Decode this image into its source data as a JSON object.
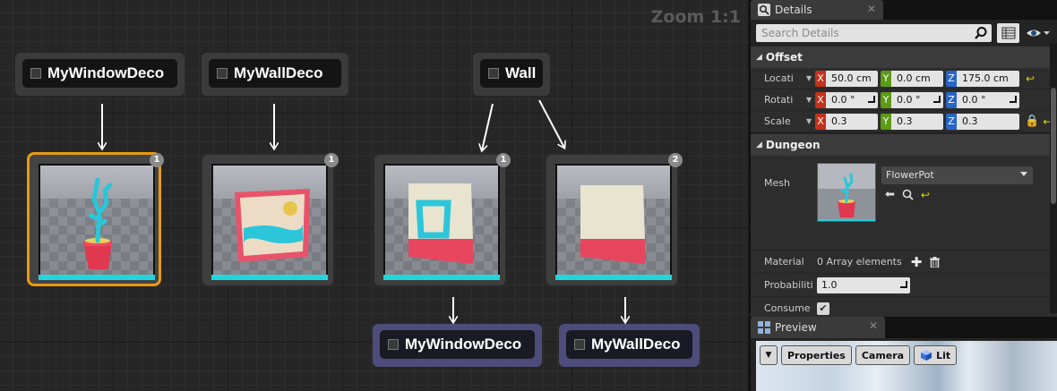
{
  "graph": {
    "zoom_label": "Zoom 1:1",
    "markers": {
      "top_left": "MyWindowDeco",
      "top_mid": "MyWallDeco",
      "top_right": "Wall",
      "bottom_left": "MyWindowDeco",
      "bottom_right": "MyWallDeco"
    },
    "visual_nodes": [
      {
        "badge": "1",
        "content": "flower-pot"
      },
      {
        "badge": "1",
        "content": "painting"
      },
      {
        "badge": "1",
        "content": "window-wall"
      },
      {
        "badge": "2",
        "content": "plain-wall"
      }
    ]
  },
  "details": {
    "tab_title": "Details",
    "search_placeholder": "Search Details",
    "sections": {
      "offset": "Offset",
      "dungeon": "Dungeon"
    },
    "transform": {
      "location_label": "Locati",
      "rotation_label": "Rotati",
      "scale_label": "Scale",
      "location": {
        "x": "50.0 cm",
        "y": "0.0 cm",
        "z": "175.0 cm"
      },
      "rotation": {
        "x": "0.0 °",
        "y": "0.0 °",
        "z": "0.0 °"
      },
      "scale": {
        "x": "0.3",
        "y": "0.3",
        "z": "0.3"
      }
    },
    "axis_labels": {
      "x": "X",
      "y": "Y",
      "z": "Z"
    },
    "mesh_label": "Mesh",
    "mesh_value": "FlowerPot",
    "material_label": "Material",
    "material_value": "0 Array elements",
    "probability_label": "Probabiliti",
    "probability_value": "1.0",
    "consume_label": "Consume",
    "consume_checked": true
  },
  "preview": {
    "tab_title": "Preview",
    "buttons": {
      "properties": "Properties",
      "camera": "Camera",
      "lit": "Lit"
    }
  },
  "colors": {
    "selection": "#e89a12",
    "accent_cyan": "#1fd6df",
    "axis_x": "#c3321b",
    "axis_y": "#5d9a16",
    "axis_z": "#2765c7"
  }
}
